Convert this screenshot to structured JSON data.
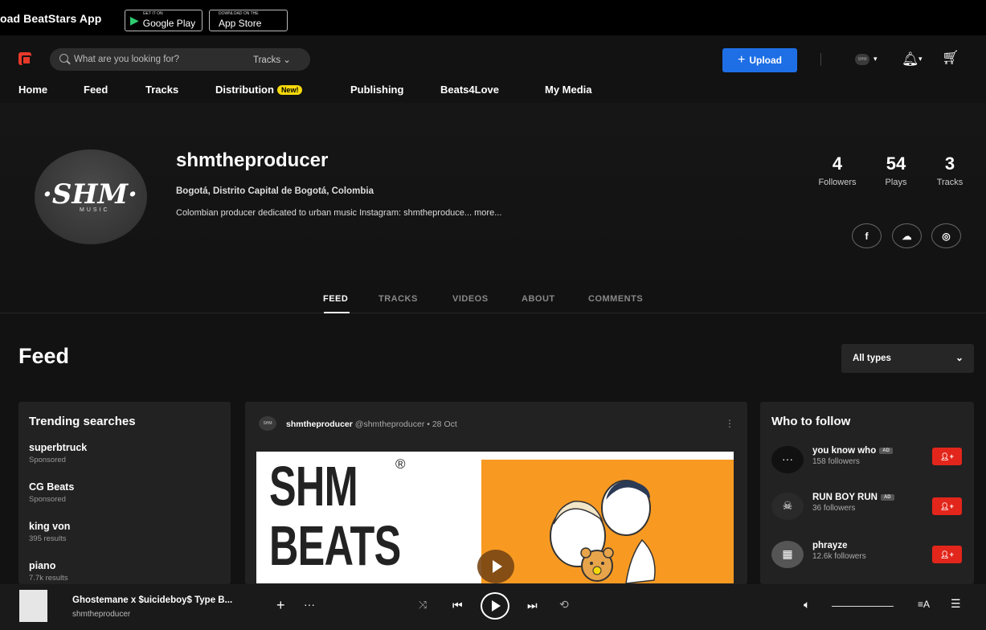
{
  "app_banner": {
    "title": "oad BeatStars App",
    "google_play": {
      "small": "GET IT ON",
      "big": "Google Play"
    },
    "app_store": {
      "small": "Download on the",
      "big": "App Store"
    }
  },
  "header": {
    "search_placeholder": "What are you looking for?",
    "search_scope": "Tracks ⌄",
    "upload_label": "Upload",
    "avatar_text": "SHM",
    "nav": [
      {
        "label": "Home"
      },
      {
        "label": "Feed"
      },
      {
        "label": "Tracks"
      },
      {
        "label": "Distribution",
        "badge": "New!"
      },
      {
        "label": "Publishing"
      },
      {
        "label": "Beats4Love"
      },
      {
        "label": "My Media"
      }
    ]
  },
  "profile": {
    "avatar_mark": "·SHM·",
    "avatar_sub": "MUSIC",
    "username": "shmtheproducer",
    "location": "Bogotá, Distrito Capital de Bogotá, Colombia",
    "bio": "Colombian producer dedicated to urban music Instagram: shmtheproduce... more...",
    "stats": {
      "followers": {
        "value": "4",
        "label": "Followers"
      },
      "plays": {
        "value": "54",
        "label": "Plays"
      },
      "tracks": {
        "value": "3",
        "label": "Tracks"
      }
    },
    "social": {
      "facebook": "f",
      "soundcloud": "☁",
      "instagram": "◎"
    },
    "tabs": [
      "FEED",
      "TRACKS",
      "VIDEOS",
      "ABOUT",
      "COMMENTS"
    ]
  },
  "feed": {
    "title": "Feed",
    "filter": "All types",
    "trending": {
      "title": "Trending searches",
      "items": [
        {
          "name": "superbtruck",
          "meta": "Sponsored"
        },
        {
          "name": "CG Beats",
          "meta": "Sponsored"
        },
        {
          "name": "king von",
          "meta": "395 results"
        },
        {
          "name": "piano",
          "meta": "7.7k results"
        }
      ]
    },
    "post": {
      "avatar_text": "SHM",
      "author": "shmtheproducer",
      "handle": "@shmtheproducer",
      "date": "28 Oct",
      "art_line1": "SHM",
      "art_line2": "BEATS",
      "art_reg": "®"
    },
    "who_to_follow": {
      "title": "Who to follow",
      "ad_label": "AD",
      "items": [
        {
          "name": "you know who",
          "ad": true,
          "count": "158 followers",
          "avatar": "···"
        },
        {
          "name": "RUN BOY RUN",
          "ad": true,
          "count": "36 followers",
          "avatar": "☠"
        },
        {
          "name": "phrayze",
          "ad": false,
          "count": "12.6k followers",
          "avatar": "▦"
        }
      ]
    }
  },
  "player": {
    "track_title": "Ghostemane x $uicideboy$ Type B...",
    "artist": "shmtheproducer"
  },
  "colors": {
    "accent_blue": "#1e6fe6",
    "follow_red": "#e3261b",
    "badge_yellow": "#f5d90a",
    "brand_red": "#e8392a"
  }
}
